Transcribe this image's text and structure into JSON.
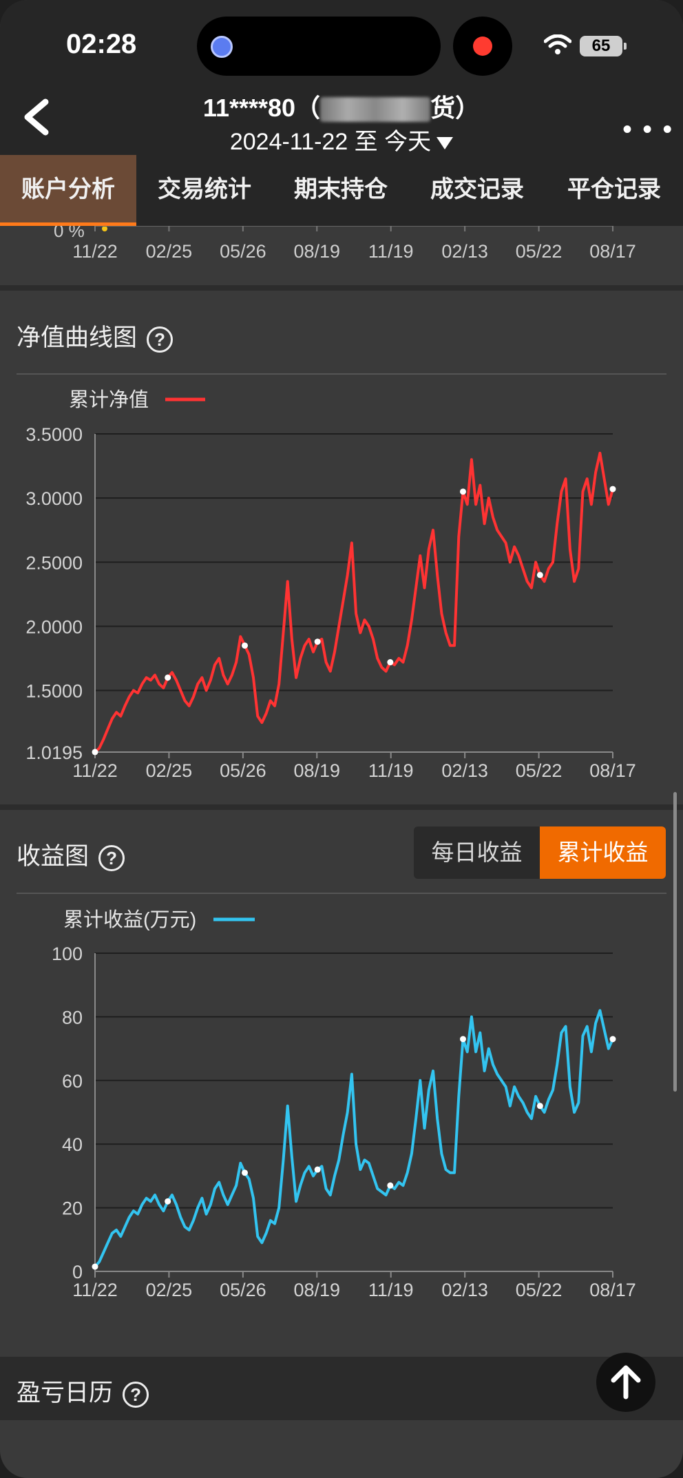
{
  "status_bar": {
    "time": "02:28",
    "battery": "65"
  },
  "header": {
    "account": "11****80（",
    "account_suffix": "货）",
    "date_range": "2024-11-22 至 今天",
    "more_icon": "more-icon"
  },
  "tabs": [
    {
      "label": "账户分析",
      "active": true
    },
    {
      "label": "交易统计"
    },
    {
      "label": "期末持仓"
    },
    {
      "label": "成交记录"
    },
    {
      "label": "平仓记录"
    }
  ],
  "prev_chart": {
    "y_label": "0 %",
    "x_ticks": [
      "11/22",
      "02/25",
      "05/26",
      "08/19",
      "11/19",
      "02/13",
      "05/22",
      "08/17"
    ]
  },
  "nav_chart": {
    "title": "净值曲线图",
    "help": "?",
    "legend": "累计净值",
    "color": "#ff3333",
    "y_ticks": [
      "3.5000",
      "3.0000",
      "2.5000",
      "2.0000",
      "1.5000",
      "1.0195"
    ],
    "x_ticks": [
      "11/22",
      "02/25",
      "05/26",
      "08/19",
      "11/19",
      "02/13",
      "05/22",
      "08/17"
    ]
  },
  "profit_chart": {
    "title": "收益图",
    "help": "?",
    "toggle_daily": "每日收益",
    "toggle_cumulative": "累计收益",
    "legend": "累计收益(万元)",
    "color": "#33c4f0",
    "y_ticks": [
      "100",
      "80",
      "60",
      "40",
      "20",
      "0"
    ],
    "x_ticks": [
      "11/22",
      "02/25",
      "05/26",
      "08/19",
      "11/19",
      "02/13",
      "05/22",
      "08/17"
    ]
  },
  "calendar": {
    "title": "盈亏日历",
    "help": "?"
  },
  "chart_data": [
    {
      "type": "line",
      "legend": "累计净值",
      "ylim": [
        1.0195,
        3.5
      ],
      "x": [
        "11/22",
        "02/25",
        "05/26",
        "08/19",
        "11/19",
        "02/13",
        "05/22",
        "08/17"
      ],
      "series": [
        {
          "name": "累计净值",
          "values": [
            1.02,
            1.05,
            1.12,
            1.2,
            1.28,
            1.33,
            1.3,
            1.38,
            1.45,
            1.5,
            1.48,
            1.55,
            1.6,
            1.58,
            1.62,
            1.55,
            1.52,
            1.6,
            1.64,
            1.58,
            1.5,
            1.42,
            1.38,
            1.45,
            1.55,
            1.6,
            1.5,
            1.58,
            1.7,
            1.75,
            1.62,
            1.55,
            1.62,
            1.72,
            1.92,
            1.85,
            1.78,
            1.6,
            1.3,
            1.25,
            1.32,
            1.42,
            1.38,
            1.55,
            1.95,
            2.35,
            1.9,
            1.6,
            1.75,
            1.85,
            1.9,
            1.8,
            1.88,
            1.9,
            1.72,
            1.65,
            1.8,
            2.0,
            2.2,
            2.4,
            2.65,
            2.1,
            1.95,
            2.05,
            2.0,
            1.9,
            1.75,
            1.68,
            1.65,
            1.72,
            1.7,
            1.75,
            1.72,
            1.85,
            2.05,
            2.3,
            2.55,
            2.3,
            2.6,
            2.75,
            2.4,
            2.1,
            1.95,
            1.85,
            1.85,
            2.7,
            3.05,
            2.95,
            3.3,
            2.95,
            3.1,
            2.8,
            3.0,
            2.85,
            2.75,
            2.7,
            2.65,
            2.5,
            2.62,
            2.55,
            2.45,
            2.35,
            2.3,
            2.5,
            2.4,
            2.35,
            2.45,
            2.5,
            2.8,
            3.05,
            3.15,
            2.6,
            2.35,
            2.45,
            3.05,
            3.15,
            2.95,
            3.2,
            3.35,
            3.15,
            2.95,
            3.07
          ]
        }
      ]
    },
    {
      "type": "line",
      "legend": "累计收益(万元)",
      "ylim": [
        0,
        100
      ],
      "x": [
        "11/22",
        "02/25",
        "05/26",
        "08/19",
        "11/19",
        "02/13",
        "05/22",
        "08/17"
      ],
      "series": [
        {
          "name": "累计收益(万元)",
          "values": [
            1.5,
            3,
            6,
            9,
            12,
            13,
            11,
            14,
            17,
            19,
            18,
            21,
            23,
            22,
            24,
            21,
            19,
            22,
            24,
            21,
            17,
            14,
            13,
            16,
            20,
            23,
            18,
            21,
            26,
            28,
            24,
            21,
            24,
            27,
            34,
            31,
            29,
            23,
            11,
            9,
            12,
            16,
            15,
            20,
            35,
            52,
            36,
            22,
            27,
            31,
            33,
            30,
            32,
            33,
            26,
            24,
            30,
            35,
            43,
            50,
            62,
            40,
            32,
            35,
            34,
            30,
            26,
            25,
            24,
            27,
            26,
            28,
            27,
            31,
            37,
            48,
            60,
            45,
            57,
            63,
            48,
            37,
            32,
            31,
            31,
            55,
            73,
            69,
            80,
            69,
            75,
            63,
            70,
            65,
            62,
            60,
            58,
            52,
            58,
            55,
            53,
            50,
            48,
            55,
            52,
            50,
            54,
            57,
            65,
            75,
            77,
            58,
            50,
            53,
            74,
            77,
            69,
            78,
            82,
            76,
            70,
            73
          ]
        }
      ]
    }
  ]
}
